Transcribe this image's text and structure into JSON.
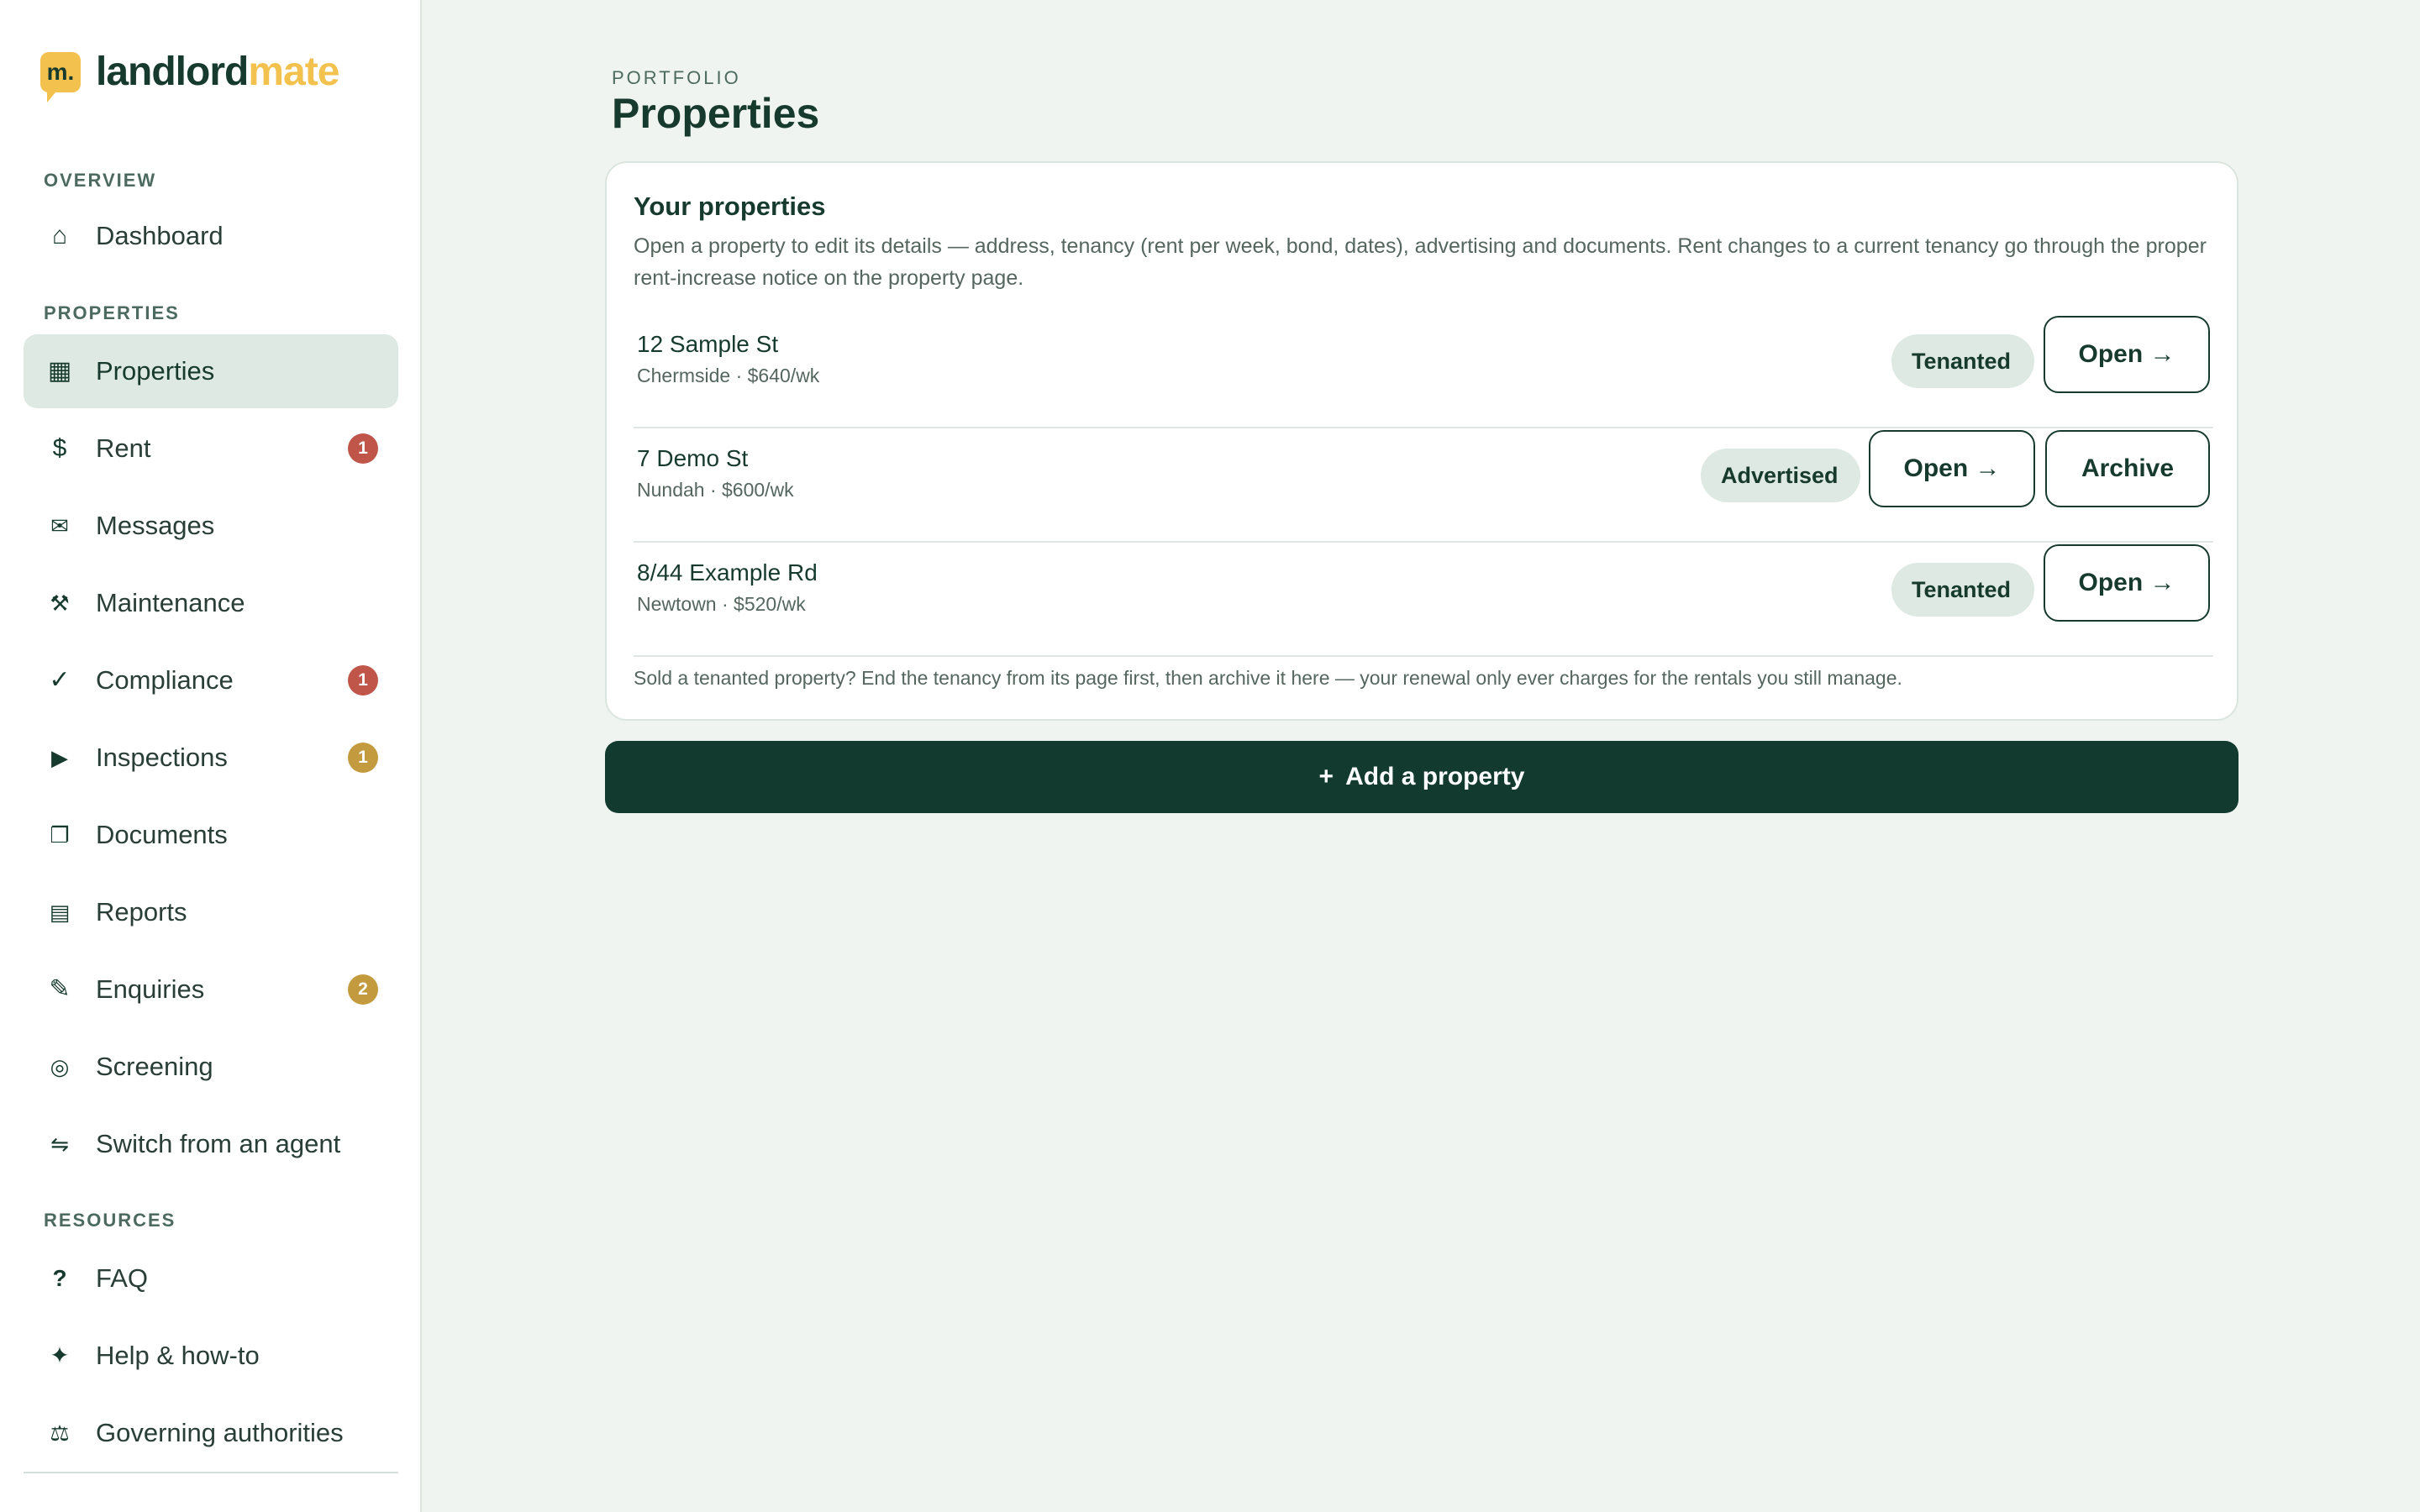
{
  "brand": {
    "mark": "m.",
    "name_part1": "landlord",
    "name_part2": "mate"
  },
  "sidebar": {
    "sections": [
      {
        "label": "OVERVIEW"
      },
      {
        "label": "PROPERTIES"
      },
      {
        "label": "RESOURCES"
      }
    ],
    "items": [
      {
        "label": "Dashboard",
        "icon": "home-icon",
        "glyph": "⌂"
      },
      {
        "label": "Properties",
        "icon": "grid-icon",
        "glyph": "▦",
        "active": true
      },
      {
        "label": "Rent",
        "icon": "dollar-icon",
        "glyph": "$",
        "badge": "1"
      },
      {
        "label": "Messages",
        "icon": "mail-icon",
        "glyph": "✉"
      },
      {
        "label": "Maintenance",
        "icon": "tools-icon",
        "glyph": "⚒"
      },
      {
        "label": "Compliance",
        "icon": "check-icon",
        "glyph": "✓",
        "badge": "1"
      },
      {
        "label": "Inspections",
        "icon": "play-icon",
        "glyph": "▶",
        "badge": "1"
      },
      {
        "label": "Documents",
        "icon": "document-icon",
        "glyph": "❐"
      },
      {
        "label": "Reports",
        "icon": "report-icon",
        "glyph": "▤"
      },
      {
        "label": "Enquiries",
        "icon": "pencil-icon",
        "glyph": "✎",
        "badge": "2"
      },
      {
        "label": "Screening",
        "icon": "target-icon",
        "glyph": "◎"
      },
      {
        "label": "Switch from an agent",
        "icon": "switch-icon",
        "glyph": "⇋"
      },
      {
        "label": "FAQ",
        "icon": "question-icon",
        "glyph": "?"
      },
      {
        "label": "Help & how-to",
        "icon": "sparkle-icon",
        "glyph": "✦"
      },
      {
        "label": "Governing authorities",
        "icon": "authority-icon",
        "glyph": "⚖"
      }
    ]
  },
  "header": {
    "eyebrow": "PORTFOLIO",
    "title": "Properties"
  },
  "card": {
    "title": "Your properties",
    "description": "Open a property to edit its details — address, tenancy (rent per week, bond, dates), advertising and documents. Rent changes to a current tenancy go through the proper rent-increase notice on the property page.",
    "properties": [
      {
        "address": "12 Sample St",
        "meta": "Chermside · $640/wk",
        "status": "Tenanted",
        "open_label": "Open →"
      },
      {
        "address": "7 Demo St",
        "meta": "Nundah · $600/wk",
        "status": "Advertised",
        "open_label": "Open →",
        "archive_label": "Archive"
      },
      {
        "address": "8/44 Example Rd",
        "meta": "Newtown · $520/wk",
        "status": "Tenanted",
        "open_label": "Open →"
      }
    ],
    "footnote": "Sold a tenanted property? End the tenancy from its page first, then archive it here — your renewal only ever charges for the rentals you still manage."
  },
  "add_button": {
    "plus": "+",
    "label": "Add a property"
  },
  "colors": {
    "accent_dark": "#123a2f",
    "brand_yellow": "#f2c14e",
    "badge_red": "#c0564a",
    "badge_gold": "#c49a3e",
    "pill_bg": "#dde9e2"
  }
}
